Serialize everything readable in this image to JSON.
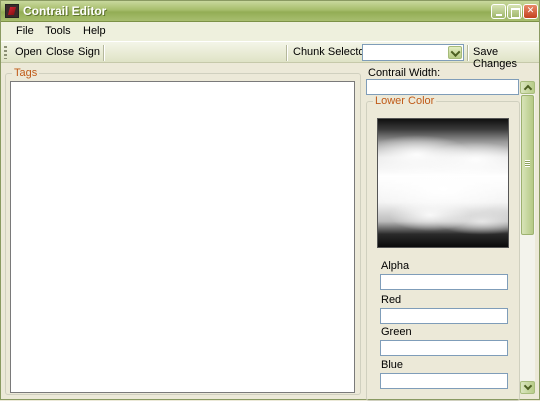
{
  "window": {
    "title": "Contrail Editor"
  },
  "menubar": {
    "items": [
      "File",
      "Tools",
      "Help"
    ]
  },
  "toolbar": {
    "open_label": "Open",
    "close_label": "Close",
    "sign_label": "Sign",
    "chunk_selector_label": "Chunk Selector:",
    "chunk_selector_value": "",
    "save_label": "Save Changes"
  },
  "tags": {
    "legend": "Tags"
  },
  "properties": {
    "contrail_width_label": "Contrail Width:",
    "contrail_width_value": "",
    "lower_color_legend": "Lower Color",
    "alpha_label": "Alpha",
    "alpha_value": "",
    "red_label": "Red",
    "red_value": "",
    "green_label": "Green",
    "green_value": "",
    "blue_label": "Blue",
    "blue_value": ""
  },
  "colors": {
    "titlebar": "#a6bd6b",
    "legend_text": "#c05a18",
    "window_bg": "#ece9d8"
  }
}
